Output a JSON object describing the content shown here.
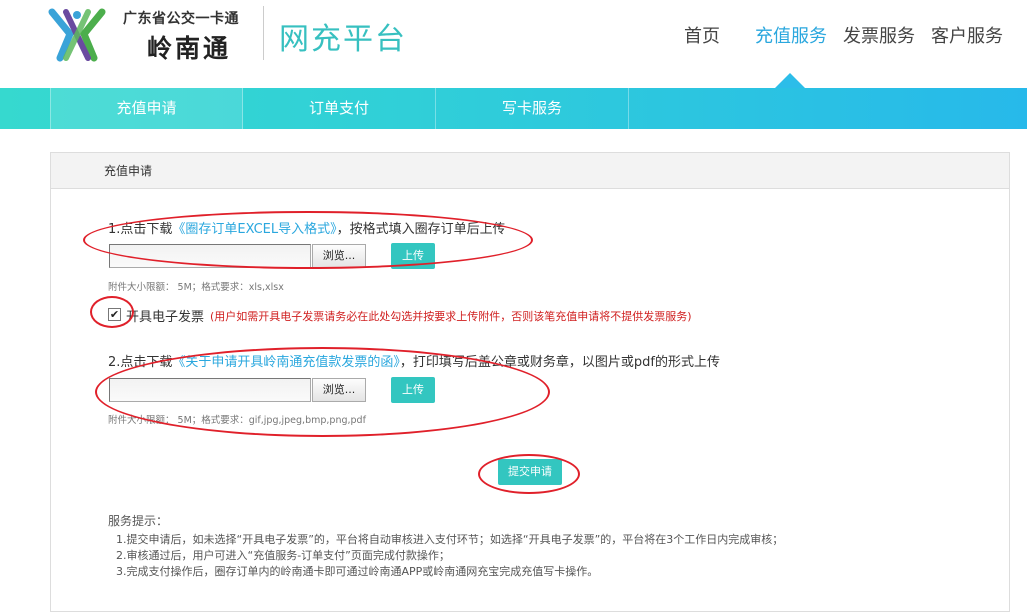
{
  "header": {
    "logo_subtitle": "广东省公交一卡通",
    "logo_name": "岭南通",
    "platform_title": "网充平台",
    "nav": [
      {
        "label": "首页",
        "active": false
      },
      {
        "label": "充值服务",
        "active": true
      },
      {
        "label": "发票服务",
        "active": false
      },
      {
        "label": "客户服务",
        "active": false
      }
    ]
  },
  "subnav": {
    "tabs": [
      "充值申请",
      "订单支付",
      "写卡服务"
    ]
  },
  "panel": {
    "title": "充值申请",
    "step1": {
      "prefix": "1.点击下载",
      "link": "《圈存订单EXCEL导入格式》",
      "suffix": "，按格式填入圈存订单后上传",
      "browse_label": "浏览...",
      "upload_label": "上传",
      "hint": "附件大小限额： 5M；格式要求：xls,xlsx"
    },
    "invoice": {
      "checked": true,
      "check_glyph": "✔",
      "label": "开具电子发票",
      "note": "(用户如需开具电子发票请务必在此处勾选并按要求上传附件，否则该笔充值申请将不提供发票服务)"
    },
    "step2": {
      "prefix": "2.点击下载",
      "link": "《关于申请开具岭南通充值款发票的函》",
      "suffix": "，打印填写后盖公章或财务章，以图片或pdf的形式上传",
      "browse_label": "浏览...",
      "upload_label": "上传",
      "hint": "附件大小限额： 5M；格式要求：gif,jpg,jpeg,bmp,png,pdf"
    },
    "submit_label": "提交申请",
    "tips": {
      "title": "服务提示：",
      "lines": [
        "1.提交申请后，如未选择“开具电子发票”的，平台将自动审核进入支付环节；如选择“开具电子发票”的，平台将在3个工作日内完成审核；",
        "2.审核通过后，用户可进入“充值服务-订单支付”页面完成付款操作；",
        "3.完成支付操作后，圈存订单内的岭南通卡即可通过岭南通APP或岭南通网充宝完成充值写卡操作。"
      ]
    }
  },
  "colors": {
    "accent": "#2aa7de",
    "teal": "#33c6c0",
    "annotation": "#e0202a",
    "warning": "#d02020"
  }
}
